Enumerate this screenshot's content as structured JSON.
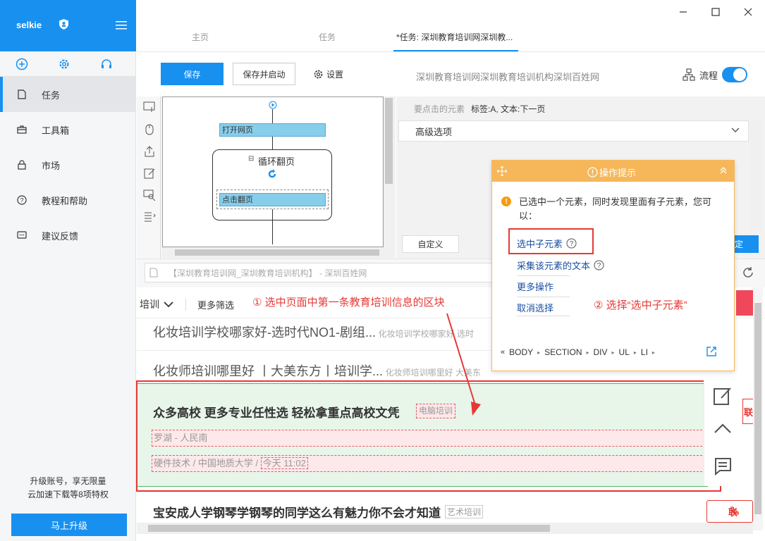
{
  "sidebar": {
    "brand": "selkie",
    "nav": [
      {
        "label": "任务",
        "icon": "file-icon",
        "active": true
      },
      {
        "label": "工具箱",
        "icon": "toolbox-icon",
        "active": false
      },
      {
        "label": "市场",
        "icon": "lock-icon",
        "active": false
      },
      {
        "label": "教程和帮助",
        "icon": "help-circle-icon",
        "active": false
      },
      {
        "label": "建议反馈",
        "icon": "chat-icon",
        "active": false
      }
    ],
    "promo_line1": "升级账号，享无限量",
    "promo_line2": "云加速下载等8项特权",
    "upgrade_label": "马上升级"
  },
  "tabs": [
    {
      "label": "主页"
    },
    {
      "label": "任务"
    },
    {
      "label": "*任务: 深圳教育培训网深圳教..."
    }
  ],
  "toolbar": {
    "save_label": "保存",
    "save_run_label": "保存并启动",
    "settings_label": "设置",
    "url_hint": "深圳教育培训网深圳教育培训机构深圳百姓网",
    "flow_label": "流程",
    "flow_enabled": true
  },
  "designer": {
    "open_page": "打开网页",
    "loop_title": "循环翻页",
    "loop_toggle": "⊟",
    "click_page": "点击翻页"
  },
  "panel": {
    "target_label": "要点击的元素",
    "target_value": "标签:A, 文本:下一页",
    "advanced_label": "高级选项",
    "custom_label": "自定义",
    "confirm_label": "定"
  },
  "browser": {
    "address": "【深圳教育培训网_深圳教育培训机构】 - 深圳百姓网"
  },
  "page": {
    "filter1": "培训",
    "filter2": "更多筛选",
    "rows": [
      {
        "title": "化妆培训学校哪家好-选时代NO1-剧组...",
        "sub": "化妆培训学校哪家好 选时"
      },
      {
        "title": "化妆师培训哪里好 丨大美东方丨培训学...",
        "sub": "化妆师培训哪里好 大美东"
      }
    ],
    "highlight": {
      "title": "众多高校 更多专业任性选 轻松拿重点高校文凭",
      "tag": "电脑培训",
      "location": "罗湖 - 人民南",
      "meta": "硬件技术 / 中国地质大学 / ",
      "time": "今天 11:02"
    },
    "next_row": {
      "title": "宝安成人学钢琴学钢琴的同学这么有魅力你不会才知道",
      "tag": "艺术培训"
    },
    "side_btn1": "联",
    "side_btn2": "联"
  },
  "tip": {
    "title": "操作提示",
    "message": "已选中一个元素，同时发现里面有子元素，您可以：",
    "options": [
      "选中子元素",
      "采集该元素的文本",
      "更多操作",
      "取消选择"
    ],
    "breadcrumb": [
      "BODY",
      "SECTION",
      "DIV",
      "UL",
      "LI"
    ]
  },
  "annotations": {
    "step1": "① 选中页面中第一条教育培训信息的区块",
    "step2": "② 选择“选中子元素”"
  },
  "colors": {
    "accent": "#1890f0",
    "tip": "#f6b75a",
    "annotation": "#e53935"
  }
}
